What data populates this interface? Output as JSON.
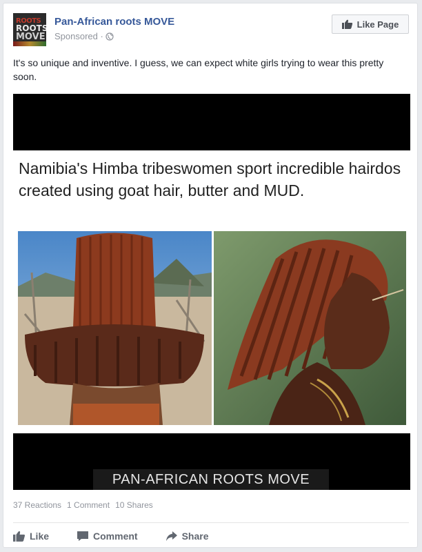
{
  "post": {
    "page_name": "Pan-African roots MOVE",
    "sponsored": "Sponsored ·",
    "like_page_label": "Like Page",
    "text": "It's so unique and inventive. I guess, we can expect white girls trying to wear this pretty soon."
  },
  "media": {
    "headline": "Namibia's Himba tribeswomen sport incredible hairdos created using goat hair, butter and MUD.",
    "banner": "PAN-AFRICAN ROOTS MOVE",
    "avatar_logo": [
      "ROOTS",
      "ROOTS",
      "MOVE"
    ]
  },
  "stats": {
    "reactions": "37 Reactions",
    "comments": "1 Comment",
    "shares": "10 Shares"
  },
  "actions": {
    "like": "Like",
    "comment": "Comment",
    "share": "Share"
  },
  "colors": {
    "link": "#365899",
    "muted": "#90949c",
    "action": "#616770"
  },
  "icons": [
    "globe-icon",
    "thumbs-up-icon",
    "comment-icon",
    "share-icon"
  ]
}
